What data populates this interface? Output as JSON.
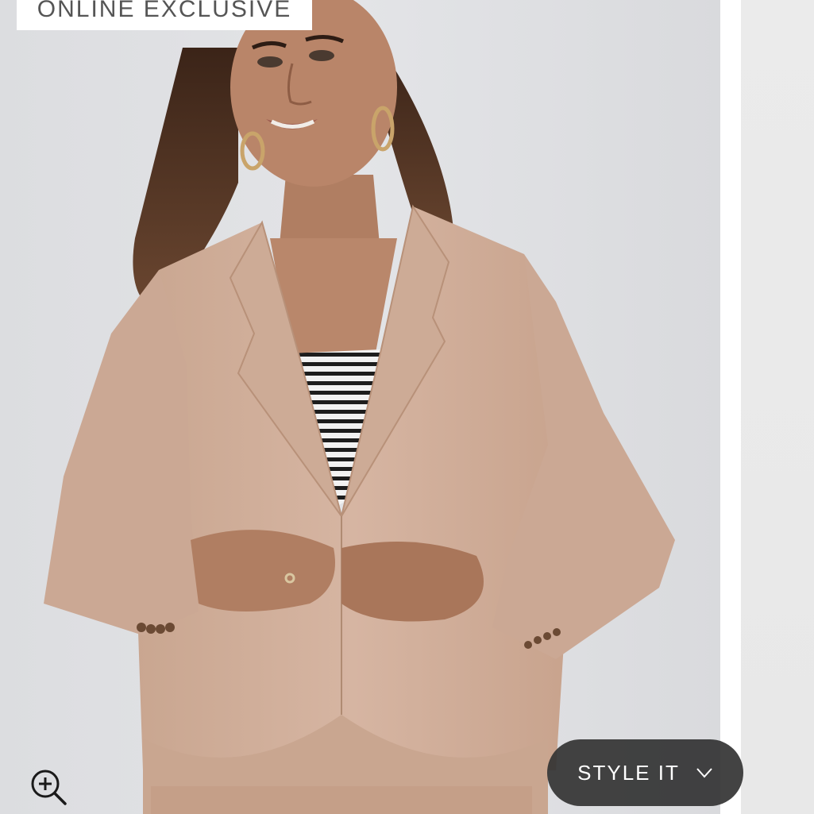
{
  "product_image": {
    "alt_subject": "model-in-tan-blazer",
    "badge": "ONLINE EXCLUSIVE"
  },
  "controls": {
    "zoom_icon": "zoom-in-icon",
    "style_it_label": "STYLE IT",
    "style_it_icon": "chevron-down-icon"
  },
  "colors": {
    "badge_text": "#555555",
    "style_it_bg": "#333333",
    "style_it_text": "#ffffff",
    "blazer": "#d3b19d",
    "background": "#e0e1e4"
  }
}
